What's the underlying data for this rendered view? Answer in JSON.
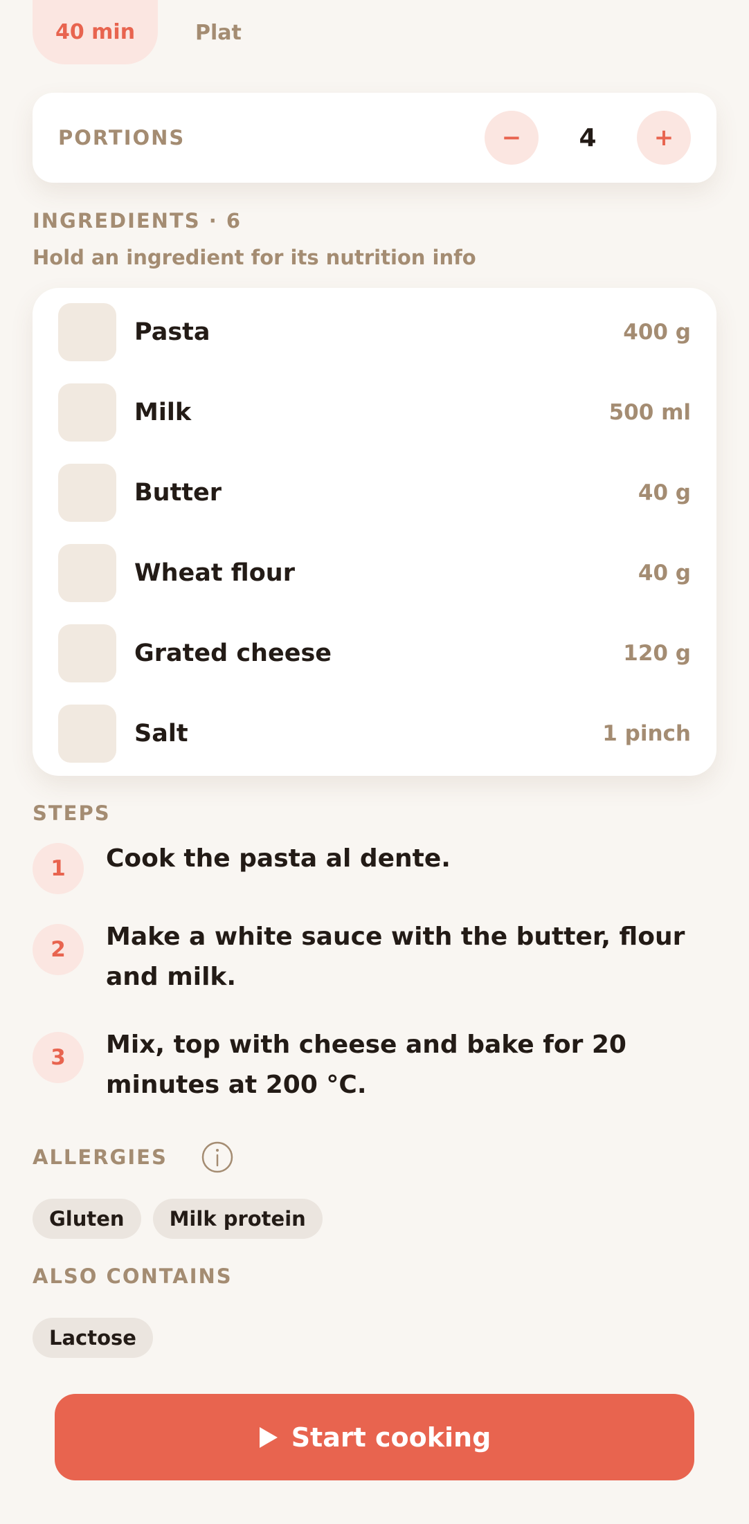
{
  "tags": {
    "time": "40 min",
    "type": "Plat"
  },
  "portions": {
    "label": "PORTIONS",
    "minus": "−",
    "value": "4",
    "plus": "+"
  },
  "ingredients": {
    "heading": "INGREDIENTS · 6",
    "hint": "Hold an ingredient for its nutrition info",
    "items": [
      {
        "name": "Pasta",
        "qty": "400 g"
      },
      {
        "name": "Milk",
        "qty": "500 ml"
      },
      {
        "name": "Butter",
        "qty": "40 g"
      },
      {
        "name": "Wheat flour",
        "qty": "40 g"
      },
      {
        "name": "Grated cheese",
        "qty": "120 g"
      },
      {
        "name": "Salt",
        "qty": "1 pinch"
      }
    ]
  },
  "steps": {
    "heading": "STEPS",
    "items": [
      {
        "num": "1",
        "text": "Cook the pasta al dente."
      },
      {
        "num": "2",
        "text": "Make a white sauce with the butter, flour and milk."
      },
      {
        "num": "3",
        "text": "Mix, top with cheese and bake for 20 minutes at 200 °C."
      }
    ]
  },
  "allergies": {
    "heading": "ALLERGIES",
    "icon": "info-icon",
    "items": [
      "Gluten",
      "Milk protein"
    ]
  },
  "also_contains": {
    "heading": "ALSO CONTAINS",
    "items": [
      "Lactose"
    ]
  },
  "cta": {
    "label": "Start cooking",
    "icon": "play-icon"
  },
  "colors": {
    "accent": "#e8644f",
    "accent_soft": "#fbe6e1",
    "muted": "#a48c72",
    "background": "#f9f6f2"
  }
}
